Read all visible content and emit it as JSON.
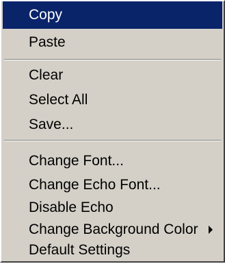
{
  "menu": {
    "items": [
      {
        "label": "Copy"
      },
      {
        "label": "Paste"
      },
      {
        "label": "Clear"
      },
      {
        "label": "Select All"
      },
      {
        "label": "Save..."
      },
      {
        "label": "Change Font..."
      },
      {
        "label": "Change Echo Font..."
      },
      {
        "label": "Disable Echo"
      },
      {
        "label": "Change Background Color",
        "icon": "submenu-arrow-icon"
      },
      {
        "label": "Default Settings"
      }
    ],
    "selected_item": "Copy",
    "colors": {
      "menu_background": "#d4d0c8",
      "selection_background": "#0a246a",
      "selection_text": "#ffffff"
    }
  }
}
